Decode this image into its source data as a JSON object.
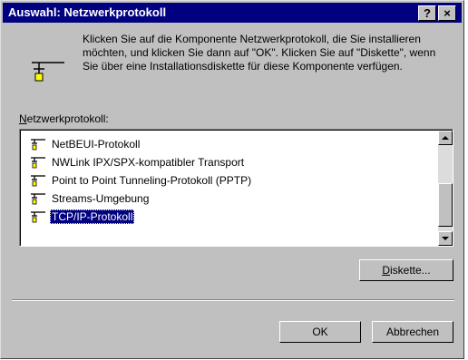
{
  "window": {
    "title": "Auswahl: Netzwerkprotokoll",
    "help_glyph": "?",
    "close_glyph": "×",
    "titlebar_color": "#000080"
  },
  "instructions": "Klicken Sie auf die Komponente Netzwerkprotokoll, die Sie installieren möchten, und klicken Sie dann auf \"OK\".  Klicken Sie auf \"Diskette\", wenn Sie über eine Installationsdiskette für diese Komponente verfügen.",
  "list": {
    "label_accel": "N",
    "label_rest": "etzwerkprotokoll:",
    "items": [
      {
        "label": "NetBEUI-Protokoll",
        "icon": "network-protocol-icon"
      },
      {
        "label": "NWLink IPX/SPX-kompatibler Transport",
        "icon": "network-protocol-icon"
      },
      {
        "label": "Point to Point Tunneling-Protokoll (PPTP)",
        "icon": "network-protocol-icon"
      },
      {
        "label": "Streams-Umgebung",
        "icon": "network-protocol-icon"
      },
      {
        "label": "TCP/IP-Protokoll",
        "icon": "network-protocol-icon",
        "selected": true
      }
    ],
    "selection_color": "#000080"
  },
  "buttons": {
    "diskette_accel": "D",
    "diskette_rest": "iskette...",
    "ok": "OK",
    "cancel": "Abbrechen"
  }
}
